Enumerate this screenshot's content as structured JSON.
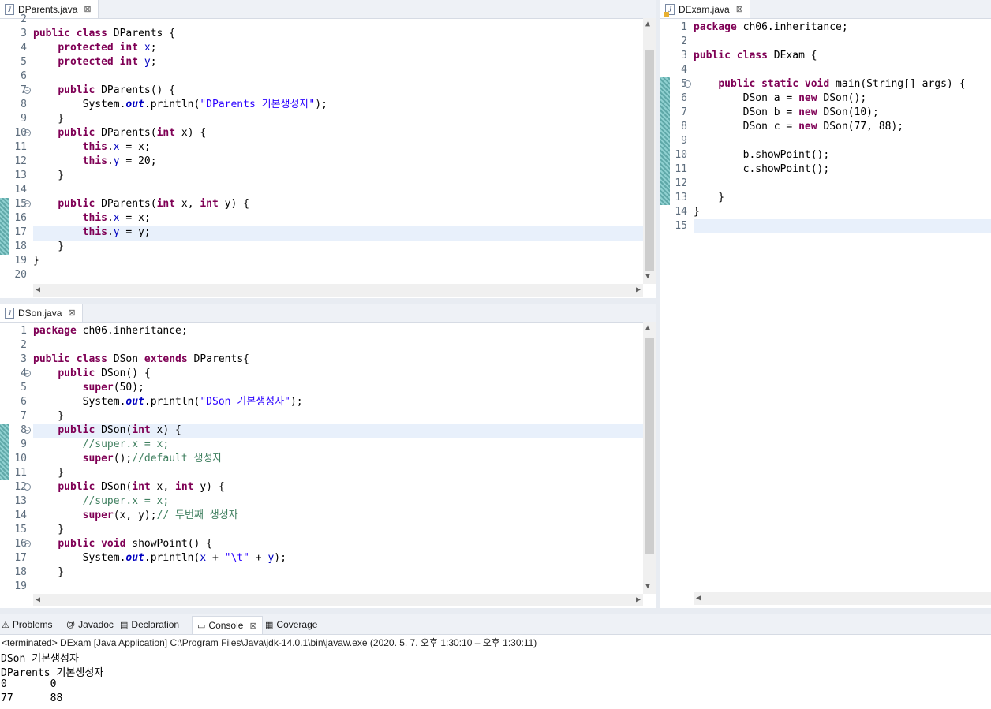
{
  "editors": {
    "dparents": {
      "tab": "DParents.java",
      "lines": [
        {
          "n": "2",
          "code": ""
        },
        {
          "n": "3",
          "code": "<span class=\"kw\">public</span> <span class=\"kw\">class</span> DParents {"
        },
        {
          "n": "4",
          "code": "    <span class=\"kw\">protected</span> <span class=\"kw\">int</span> <span class=\"fld\">x</span>;"
        },
        {
          "n": "5",
          "code": "    <span class=\"kw\">protected</span> <span class=\"kw\">int</span> <span class=\"fld\">y</span>;"
        },
        {
          "n": "6",
          "code": ""
        },
        {
          "n": "7",
          "code": "    <span class=\"kw\">public</span> DParents() {"
        },
        {
          "n": "8",
          "code": "        System.<span class=\"sfld\">out</span>.println(<span class=\"str\">\"DParents 기본생성자\"</span>);"
        },
        {
          "n": "9",
          "code": "    }"
        },
        {
          "n": "10",
          "code": "    <span class=\"kw\">public</span> DParents(<span class=\"kw\">int</span> x) {"
        },
        {
          "n": "11",
          "code": "        <span class=\"kw\">this</span>.<span class=\"fld\">x</span> = x;"
        },
        {
          "n": "12",
          "code": "        <span class=\"kw\">this</span>.<span class=\"fld\">y</span> = 20;"
        },
        {
          "n": "13",
          "code": "    }"
        },
        {
          "n": "14",
          "code": ""
        },
        {
          "n": "15",
          "code": "    <span class=\"kw\">public</span> DParents(<span class=\"kw\">int</span> x, <span class=\"kw\">int</span> y) {"
        },
        {
          "n": "16",
          "code": "        <span class=\"kw\">this</span>.<span class=\"fld\">x</span> = x;"
        },
        {
          "n": "17",
          "code": "        <span class=\"kw\">this</span>.<span class=\"fld\">y</span> = y;"
        },
        {
          "n": "18",
          "code": "    }"
        },
        {
          "n": "19",
          "code": "}"
        },
        {
          "n": "20",
          "code": ""
        }
      ]
    },
    "dson": {
      "tab": "DSon.java",
      "lines": [
        {
          "n": "1",
          "code": "<span class=\"kw\">package</span> ch06.inheritance;"
        },
        {
          "n": "2",
          "code": ""
        },
        {
          "n": "3",
          "code": "<span class=\"kw\">public</span> <span class=\"kw\">class</span> DSon <span class=\"kw\">extends</span> DParents{"
        },
        {
          "n": "4",
          "code": "    <span class=\"kw\">public</span> DSon() {"
        },
        {
          "n": "5",
          "code": "        <span class=\"kw\">super</span>(50);"
        },
        {
          "n": "6",
          "code": "        System.<span class=\"sfld\">out</span>.println(<span class=\"str\">\"DSon 기본생성자\"</span>);"
        },
        {
          "n": "7",
          "code": "    }"
        },
        {
          "n": "8",
          "code": "    <span class=\"kw\">public</span> DSon(<span class=\"kw\">int</span> x) {"
        },
        {
          "n": "9",
          "code": "        <span class=\"cmt\">//super.x = x;</span>"
        },
        {
          "n": "10",
          "code": "        <span class=\"kw\">super</span>();<span class=\"cmt\">//default 생성자</span>"
        },
        {
          "n": "11",
          "code": "    }"
        },
        {
          "n": "12",
          "code": "    <span class=\"kw\">public</span> DSon(<span class=\"kw\">int</span> x, <span class=\"kw\">int</span> y) {"
        },
        {
          "n": "13",
          "code": "        <span class=\"cmt\">//super.x = x;</span>"
        },
        {
          "n": "14",
          "code": "        <span class=\"kw\">super</span>(x, y);<span class=\"cmt\">// 두번째 생성자</span>"
        },
        {
          "n": "15",
          "code": "    }"
        },
        {
          "n": "16",
          "code": "    <span class=\"kw\">public</span> <span class=\"kw\">void</span> showPoint() {"
        },
        {
          "n": "17",
          "code": "        System.<span class=\"sfld\">out</span>.println(<span class=\"fld\">x</span> + <span class=\"str\">\"\\t\"</span> + <span class=\"fld\">y</span>);"
        },
        {
          "n": "18",
          "code": "    }"
        },
        {
          "n": "19",
          "code": ""
        }
      ]
    },
    "dexam": {
      "tab": "DExam.java",
      "lines": [
        {
          "n": "1",
          "code": "<span class=\"kw\">package</span> ch06.inheritance;"
        },
        {
          "n": "2",
          "code": ""
        },
        {
          "n": "3",
          "code": "<span class=\"kw\">public</span> <span class=\"kw\">class</span> DExam {"
        },
        {
          "n": "4",
          "code": ""
        },
        {
          "n": "5",
          "code": "    <span class=\"kw\">public</span> <span class=\"kw\">static</span> <span class=\"kw\">void</span> main(String[] args) {"
        },
        {
          "n": "6",
          "code": "        DSon a = <span class=\"kw\">new</span> DSon();"
        },
        {
          "n": "7",
          "code": "        DSon b = <span class=\"kw\">new</span> DSon(10);"
        },
        {
          "n": "8",
          "code": "        DSon c = <span class=\"kw\">new</span> DSon(77, 88);"
        },
        {
          "n": "9",
          "code": ""
        },
        {
          "n": "10",
          "code": "        b.showPoint();"
        },
        {
          "n": "11",
          "code": "        c.showPoint();"
        },
        {
          "n": "12",
          "code": ""
        },
        {
          "n": "13",
          "code": "    }"
        },
        {
          "n": "14",
          "code": "}"
        },
        {
          "n": "15",
          "code": ""
        }
      ]
    }
  },
  "bottom_tabs": [
    {
      "label": "Problems",
      "icon": "problems-icon",
      "glyph": "⚠"
    },
    {
      "label": "Javadoc",
      "icon": "javadoc-icon",
      "glyph": "@"
    },
    {
      "label": "Declaration",
      "icon": "declaration-icon",
      "glyph": "▤"
    },
    {
      "label": "Console",
      "icon": "console-icon",
      "glyph": "▭"
    },
    {
      "label": "Coverage",
      "icon": "coverage-icon",
      "glyph": "▦"
    }
  ],
  "console": {
    "status": "<terminated> DExam [Java Application] C:\\Program Files\\Java\\jdk-14.0.1\\bin\\javaw.exe  (2020. 5. 7. 오후 1:30:10 – 오후 1:30:11)",
    "output": [
      "DSon 기본생성자",
      "DParents 기본생성자",
      "0\t0",
      "77\t88"
    ]
  }
}
